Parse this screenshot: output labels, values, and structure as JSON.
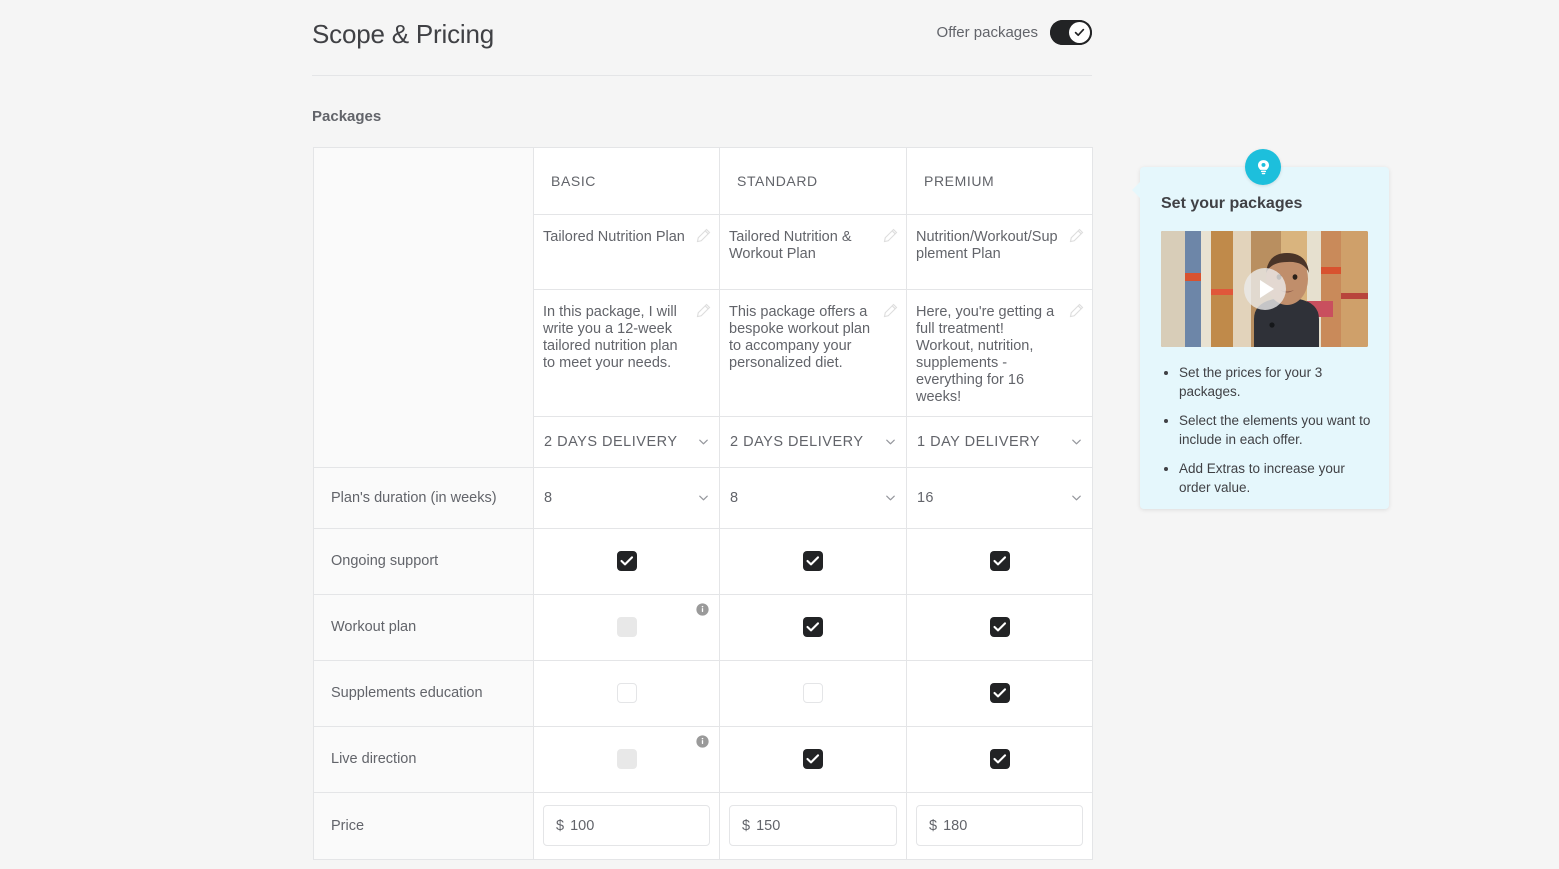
{
  "header": {
    "title": "Scope & Pricing",
    "offer_label": "Offer packages",
    "offer_toggle_state": "on"
  },
  "section": {
    "packages_label": "Packages"
  },
  "table": {
    "columns": [
      "",
      "BASIC",
      "STANDARD",
      "PREMIUM"
    ],
    "row_labels": {
      "duration": "Plan's duration (in weeks)",
      "ongoing_support": "Ongoing support",
      "workout_plan": "Workout plan",
      "supplements_education": "Supplements education",
      "live_direction": "Live direction",
      "price": "Price"
    },
    "titles": {
      "basic": "Tailored Nutrition Plan",
      "standard": "Tailored Nutrition & Workout Plan",
      "premium": "Nutrition/Workout/Supplement Plan"
    },
    "descriptions": {
      "basic": "In this package, I will write you a 12-week tailored nutrition plan to meet your needs.",
      "standard": "This package offers a bespoke workout plan to accompany your personalized diet.",
      "premium": "Here, you're getting a full treatment! Workout, nutrition, supplements - everything for 16 weeks!"
    },
    "delivery": {
      "basic": "2 DAYS DELIVERY",
      "standard": "2 DAYS DELIVERY",
      "premium": "1 DAY DELIVERY"
    },
    "duration": {
      "basic": "8",
      "standard": "8",
      "premium": "16"
    },
    "checkboxes": {
      "ongoing_support": [
        "checked",
        "checked",
        "checked"
      ],
      "workout_plan": [
        "disabled",
        "checked",
        "checked"
      ],
      "supplements_education": [
        "unchecked",
        "unchecked",
        "checked"
      ],
      "live_direction": [
        "disabled",
        "checked",
        "checked"
      ]
    },
    "info_icons": {
      "workout_plan_basic": "i",
      "live_direction_basic": "i"
    },
    "price": {
      "currency": "$",
      "basic": "100",
      "standard": "150",
      "premium": "180"
    }
  },
  "tip": {
    "title": "Set your packages",
    "bullets": [
      "Set the prices for your 3 packages.",
      "Select the elements you want to include in each offer.",
      "Add Extras to increase your order value."
    ],
    "icon": "lightbulb-icon",
    "video_play": "play-icon"
  },
  "colors": {
    "accent": "#1dbfdc",
    "tip_bg": "#e5f7fc",
    "checkbox_on": "#222325",
    "border": "#e4e5e7",
    "text": "#62646a",
    "heading": "#404145",
    "page_bg": "#f5f5f5"
  }
}
